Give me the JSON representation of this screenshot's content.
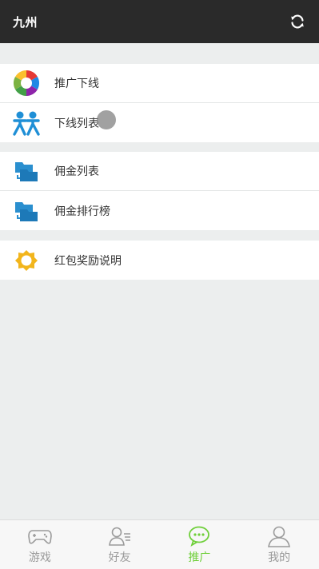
{
  "header": {
    "title": "九州",
    "refresh_icon": "refresh-icon"
  },
  "menu_groups": [
    {
      "items": [
        {
          "label": "推广下线",
          "icon": "aperture-color-icon"
        },
        {
          "label": "下线列表",
          "icon": "people-icon"
        }
      ]
    },
    {
      "items": [
        {
          "label": "佣金列表",
          "icon": "folder-transfer-icon"
        },
        {
          "label": "佣金排行榜",
          "icon": "folder-transfer-icon"
        }
      ]
    },
    {
      "items": [
        {
          "label": "红包奖励说明",
          "icon": "gold-badge-icon"
        }
      ]
    }
  ],
  "tabbar": {
    "tabs": [
      {
        "label": "游戏",
        "icon": "gamepad-icon",
        "active": false
      },
      {
        "label": "好友",
        "icon": "friends-icon",
        "active": false
      },
      {
        "label": "推广",
        "icon": "chat-bubble-icon",
        "active": true
      },
      {
        "label": "我的",
        "icon": "person-icon",
        "active": false
      }
    ]
  },
  "colors": {
    "header_bg": "#2a2a2a",
    "page_bg": "#eceeee",
    "active_tab": "#6fcf3a",
    "inactive_tab": "#9a9a9a",
    "people_icon": "#1f8fd6",
    "folder_icon": "#2a8fcf",
    "badge_icon": "#f2b51c"
  }
}
